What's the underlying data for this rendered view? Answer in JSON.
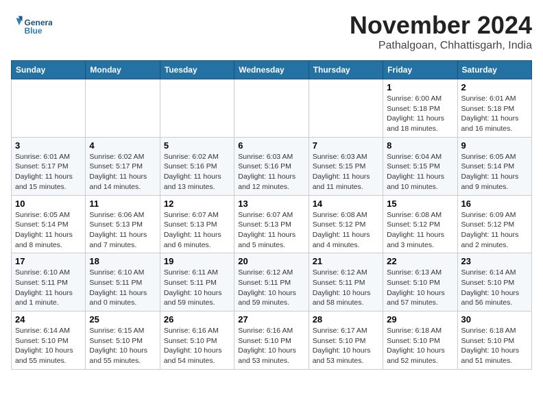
{
  "header": {
    "logo_line1": "General",
    "logo_line2": "Blue",
    "month_title": "November 2024",
    "location": "Pathalgoan, Chhattisgarh, India"
  },
  "weekdays": [
    "Sunday",
    "Monday",
    "Tuesday",
    "Wednesday",
    "Thursday",
    "Friday",
    "Saturday"
  ],
  "weeks": [
    [
      {
        "day": "",
        "info": ""
      },
      {
        "day": "",
        "info": ""
      },
      {
        "day": "",
        "info": ""
      },
      {
        "day": "",
        "info": ""
      },
      {
        "day": "",
        "info": ""
      },
      {
        "day": "1",
        "info": "Sunrise: 6:00 AM\nSunset: 5:18 PM\nDaylight: 11 hours\nand 18 minutes."
      },
      {
        "day": "2",
        "info": "Sunrise: 6:01 AM\nSunset: 5:18 PM\nDaylight: 11 hours\nand 16 minutes."
      }
    ],
    [
      {
        "day": "3",
        "info": "Sunrise: 6:01 AM\nSunset: 5:17 PM\nDaylight: 11 hours\nand 15 minutes."
      },
      {
        "day": "4",
        "info": "Sunrise: 6:02 AM\nSunset: 5:17 PM\nDaylight: 11 hours\nand 14 minutes."
      },
      {
        "day": "5",
        "info": "Sunrise: 6:02 AM\nSunset: 5:16 PM\nDaylight: 11 hours\nand 13 minutes."
      },
      {
        "day": "6",
        "info": "Sunrise: 6:03 AM\nSunset: 5:16 PM\nDaylight: 11 hours\nand 12 minutes."
      },
      {
        "day": "7",
        "info": "Sunrise: 6:03 AM\nSunset: 5:15 PM\nDaylight: 11 hours\nand 11 minutes."
      },
      {
        "day": "8",
        "info": "Sunrise: 6:04 AM\nSunset: 5:15 PM\nDaylight: 11 hours\nand 10 minutes."
      },
      {
        "day": "9",
        "info": "Sunrise: 6:05 AM\nSunset: 5:14 PM\nDaylight: 11 hours\nand 9 minutes."
      }
    ],
    [
      {
        "day": "10",
        "info": "Sunrise: 6:05 AM\nSunset: 5:14 PM\nDaylight: 11 hours\nand 8 minutes."
      },
      {
        "day": "11",
        "info": "Sunrise: 6:06 AM\nSunset: 5:13 PM\nDaylight: 11 hours\nand 7 minutes."
      },
      {
        "day": "12",
        "info": "Sunrise: 6:07 AM\nSunset: 5:13 PM\nDaylight: 11 hours\nand 6 minutes."
      },
      {
        "day": "13",
        "info": "Sunrise: 6:07 AM\nSunset: 5:13 PM\nDaylight: 11 hours\nand 5 minutes."
      },
      {
        "day": "14",
        "info": "Sunrise: 6:08 AM\nSunset: 5:12 PM\nDaylight: 11 hours\nand 4 minutes."
      },
      {
        "day": "15",
        "info": "Sunrise: 6:08 AM\nSunset: 5:12 PM\nDaylight: 11 hours\nand 3 minutes."
      },
      {
        "day": "16",
        "info": "Sunrise: 6:09 AM\nSunset: 5:12 PM\nDaylight: 11 hours\nand 2 minutes."
      }
    ],
    [
      {
        "day": "17",
        "info": "Sunrise: 6:10 AM\nSunset: 5:11 PM\nDaylight: 11 hours\nand 1 minute."
      },
      {
        "day": "18",
        "info": "Sunrise: 6:10 AM\nSunset: 5:11 PM\nDaylight: 11 hours\nand 0 minutes."
      },
      {
        "day": "19",
        "info": "Sunrise: 6:11 AM\nSunset: 5:11 PM\nDaylight: 10 hours\nand 59 minutes."
      },
      {
        "day": "20",
        "info": "Sunrise: 6:12 AM\nSunset: 5:11 PM\nDaylight: 10 hours\nand 59 minutes."
      },
      {
        "day": "21",
        "info": "Sunrise: 6:12 AM\nSunset: 5:11 PM\nDaylight: 10 hours\nand 58 minutes."
      },
      {
        "day": "22",
        "info": "Sunrise: 6:13 AM\nSunset: 5:10 PM\nDaylight: 10 hours\nand 57 minutes."
      },
      {
        "day": "23",
        "info": "Sunrise: 6:14 AM\nSunset: 5:10 PM\nDaylight: 10 hours\nand 56 minutes."
      }
    ],
    [
      {
        "day": "24",
        "info": "Sunrise: 6:14 AM\nSunset: 5:10 PM\nDaylight: 10 hours\nand 55 minutes."
      },
      {
        "day": "25",
        "info": "Sunrise: 6:15 AM\nSunset: 5:10 PM\nDaylight: 10 hours\nand 55 minutes."
      },
      {
        "day": "26",
        "info": "Sunrise: 6:16 AM\nSunset: 5:10 PM\nDaylight: 10 hours\nand 54 minutes."
      },
      {
        "day": "27",
        "info": "Sunrise: 6:16 AM\nSunset: 5:10 PM\nDaylight: 10 hours\nand 53 minutes."
      },
      {
        "day": "28",
        "info": "Sunrise: 6:17 AM\nSunset: 5:10 PM\nDaylight: 10 hours\nand 53 minutes."
      },
      {
        "day": "29",
        "info": "Sunrise: 6:18 AM\nSunset: 5:10 PM\nDaylight: 10 hours\nand 52 minutes."
      },
      {
        "day": "30",
        "info": "Sunrise: 6:18 AM\nSunset: 5:10 PM\nDaylight: 10 hours\nand 51 minutes."
      }
    ]
  ]
}
